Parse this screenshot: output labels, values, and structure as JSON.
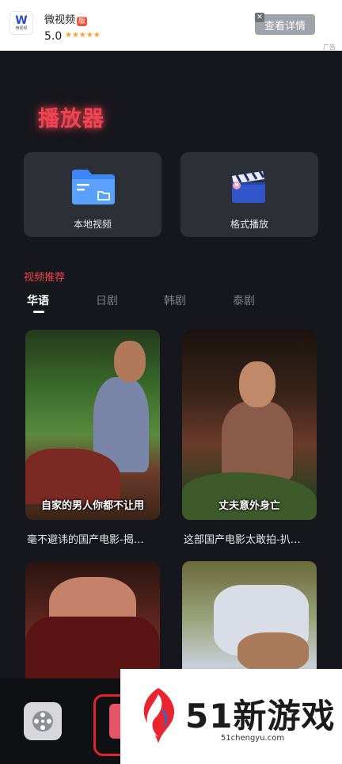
{
  "ad": {
    "logo_letter": "W",
    "logo_caption": "微视频",
    "title": "微视频",
    "title_badge": "版",
    "rating": "5.0",
    "stars": "★★★★★",
    "cta": "查看详情",
    "close": "✕",
    "mark": "广告"
  },
  "header": {
    "title": "播放器"
  },
  "features": [
    {
      "label": "本地视频",
      "icon": "folder-icon"
    },
    {
      "label": "格式播放",
      "icon": "clapperboard-icon"
    }
  ],
  "section": {
    "title": "视频推荐",
    "tabs": [
      "华语",
      "日剧",
      "韩剧",
      "泰剧"
    ],
    "active_tab": "华语"
  },
  "videos": [
    {
      "caption": "自家的男人你都不让用",
      "title": "毫不避讳的国产电影-揭…"
    },
    {
      "caption": "丈夫意外身亡",
      "title": "这部国产电影太敢拍-扒…"
    },
    {
      "caption": "",
      "title": ""
    },
    {
      "caption": "",
      "title": ""
    }
  ],
  "watermark": {
    "brand": "51新游戏",
    "url": "51chengyu.com"
  },
  "colors": {
    "accent": "#f04452",
    "background": "#16171c",
    "card": "#2d2f36"
  }
}
